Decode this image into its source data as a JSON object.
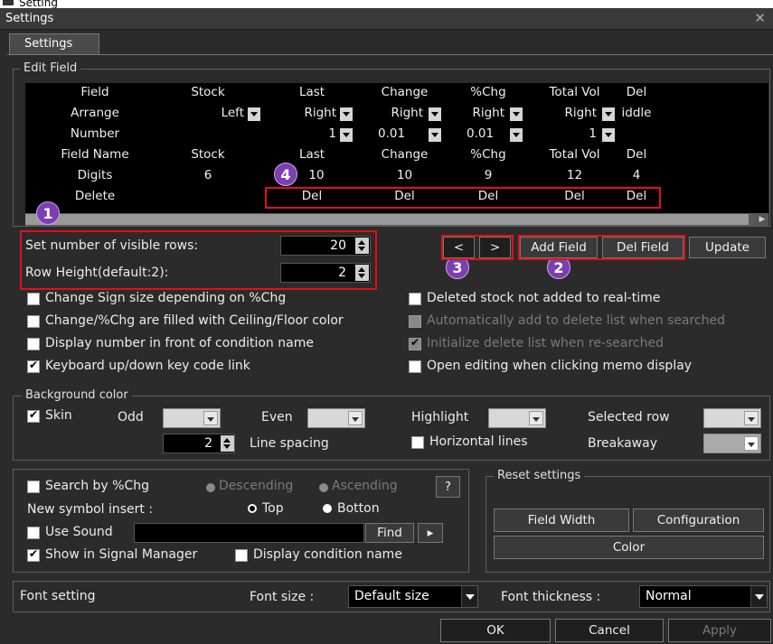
{
  "app": {
    "window_title": "Settings",
    "tab_label": "Settings",
    "top_strip": "Setting"
  },
  "edit_field": {
    "title": "Edit Field",
    "rows": [
      {
        "head": "Field",
        "cells": [
          "Stock",
          "Last",
          "Change",
          "%Chg",
          "Total Vol",
          "Del"
        ]
      },
      {
        "head": "Arrange",
        "cells": [
          "Left",
          "Right",
          "Right",
          "Right",
          "Right",
          "iddle"
        ]
      },
      {
        "head": "Number",
        "cells": [
          "",
          "1",
          "0.01",
          "0.01",
          "1",
          ""
        ]
      },
      {
        "head": "Field Name",
        "cells": [
          "Stock",
          "Last",
          "Change",
          "%Chg",
          "Total Vol",
          "Del"
        ]
      },
      {
        "head": "Digits",
        "cells": [
          "6",
          "10",
          "10",
          "9",
          "12",
          "4"
        ]
      },
      {
        "head": "Delete",
        "cells": [
          "",
          "Del",
          "Del",
          "Del",
          "Del",
          "Del"
        ]
      }
    ]
  },
  "rows_setting": {
    "visible_rows_label": "Set number of visible rows:",
    "visible_rows_value": "20",
    "row_height_label": "Row Height(default:2):",
    "row_height_value": "2"
  },
  "buttons": {
    "prev": "<",
    "next": ">",
    "add_field": "Add Field",
    "del_field": "Del Field",
    "update": "Update"
  },
  "badges": [
    "1",
    "2",
    "3",
    "4"
  ],
  "options_left": [
    {
      "label": "Change Sign size depending on %Chg",
      "checked": false
    },
    {
      "label": "Change/%Chg are filled with Ceiling/Floor color",
      "checked": false
    },
    {
      "label": "Display number in front of condition name",
      "checked": false
    },
    {
      "label": "Keyboard up/down key code link",
      "checked": true
    }
  ],
  "options_right": [
    {
      "label": "Deleted stock not added to real-time",
      "checked": false,
      "disabled": false
    },
    {
      "label": "Automatically add to delete list when searched",
      "checked": false,
      "disabled": true
    },
    {
      "label": "Initialize delete list when re-searched",
      "checked": true,
      "disabled": true
    },
    {
      "label": "Open editing when clicking memo display",
      "checked": false,
      "disabled": false
    }
  ],
  "background": {
    "title": "Background color",
    "skin": "Skin",
    "odd": "Odd",
    "even": "Even",
    "highlight": "Highlight",
    "selected_row": "Selected row",
    "line_spacing_value": "2",
    "line_spacing": "Line spacing",
    "horizontal_lines": "Horizontal lines",
    "breakaway": "Breakaway"
  },
  "search": {
    "search_by_chg": "Search by %Chg",
    "descending": "Descending",
    "ascending": "Ascending",
    "help": "?",
    "new_symbol_insert": "New symbol insert :",
    "top": "Top",
    "bottom": "Botton",
    "use_sound": "Use Sound",
    "find": "Find",
    "play": "▸",
    "show_in_signal_manager": "Show in Signal Manager",
    "display_condition_name": "Display condition name"
  },
  "reset": {
    "title": "Reset settings",
    "field_width": "Field Width",
    "configuration": "Configuration",
    "color": "Color"
  },
  "font": {
    "title": "Font setting",
    "size_label": "Font size :",
    "size_value": "Default size",
    "thickness_label": "Font thickness :",
    "thickness_value": "Normal"
  },
  "footer": {
    "ok": "OK",
    "cancel": "Cancel",
    "apply": "Apply"
  },
  "colors": {
    "accent_red": "#e0101a",
    "badge_purple": "#7b3fb2"
  }
}
